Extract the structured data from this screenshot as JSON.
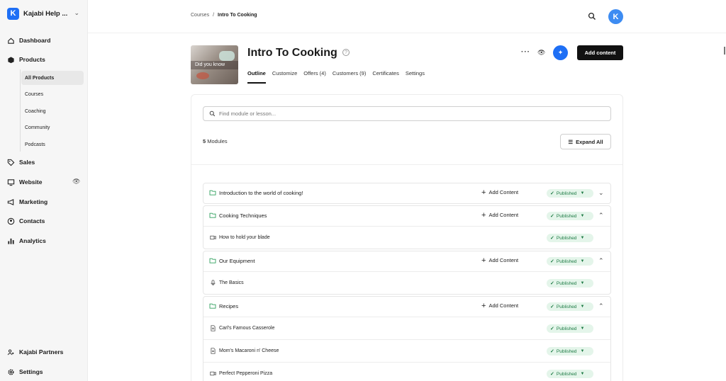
{
  "sidebar": {
    "brand": "Kajabi Help ...",
    "items": [
      {
        "label": "Dashboard",
        "icon": "home-icon"
      },
      {
        "label": "Products",
        "icon": "box-icon"
      },
      {
        "label": "Sales",
        "icon": "tag-icon"
      },
      {
        "label": "Website",
        "icon": "monitor-icon"
      },
      {
        "label": "Marketing",
        "icon": "megaphone-icon"
      },
      {
        "label": "Contacts",
        "icon": "user-circle-icon"
      },
      {
        "label": "Analytics",
        "icon": "bar-chart-icon"
      }
    ],
    "subitems": [
      "All Products",
      "Courses",
      "Coaching",
      "Community",
      "Podcasts"
    ],
    "bottom": [
      {
        "label": "Kajabi Partners",
        "icon": "partners-icon"
      },
      {
        "label": "Settings",
        "icon": "gear-icon"
      }
    ]
  },
  "breadcrumb": {
    "parent": "Courses",
    "sep": "/",
    "current": "Intro To Cooking"
  },
  "header": {
    "title": "Intro To Cooking",
    "thumb_text": "Did you know",
    "tabs": [
      "Outline",
      "Customize",
      "Offers (4)",
      "Customers (9)",
      "Certificates",
      "Settings"
    ],
    "add_content_label": "Add content"
  },
  "outline": {
    "search_placeholder": "Find module or lesson...",
    "modules_count": "5",
    "modules_label": "Modules",
    "expand_all": "Expand All",
    "add_content": "Add Content",
    "status": "Published",
    "modules": [
      {
        "title": "Introduction to the world of cooking!",
        "lessons": []
      },
      {
        "title": "Cooking Techniques",
        "lessons": [
          {
            "title": "How to hold your blade",
            "type": "video"
          }
        ]
      },
      {
        "title": "Our Equipment",
        "lessons": [
          {
            "title": "The Basics",
            "type": "audio"
          }
        ]
      },
      {
        "title": "Recipes",
        "lessons": [
          {
            "title": "Carl's Famous Casserole",
            "type": "text"
          },
          {
            "title": "Mom's Macaroni n' Cheese",
            "type": "text"
          },
          {
            "title": "Perfect Pepperoni Pizza",
            "type": "video"
          }
        ]
      }
    ]
  },
  "colors": {
    "accent": "#1e6ff5",
    "published_bg": "#e4f5ea",
    "published_text": "#1e7b45"
  }
}
